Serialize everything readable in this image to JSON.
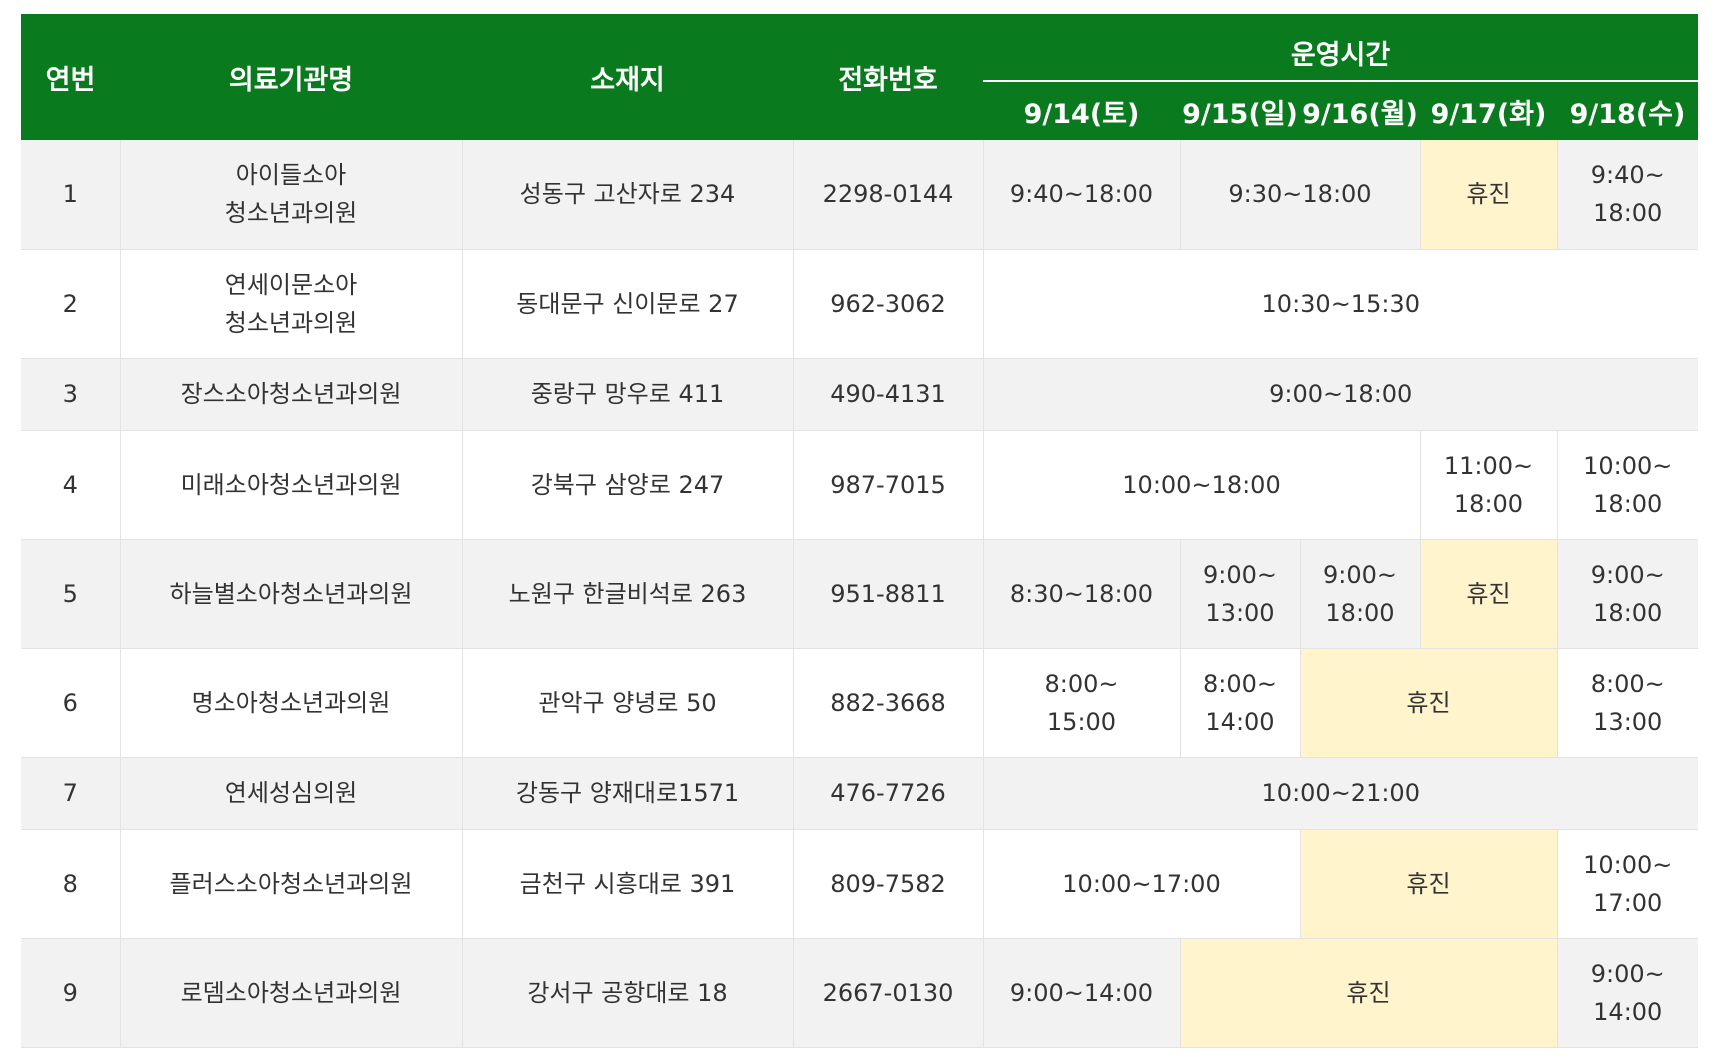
{
  "header": {
    "col_no": "연번",
    "col_name": "의료기관명",
    "col_address": "소재지",
    "col_phone": "전화번호",
    "group_hours": "운영시간",
    "dates": [
      "9/14(토)",
      "9/15(일)",
      "9/16(월)",
      "9/17(화)",
      "9/18(수)"
    ]
  },
  "closed_label": "휴진",
  "colors": {
    "header_bg": "#0a7a1e",
    "closed_bg": "#fff4cc",
    "row_alt_bg": "#f2f2f2"
  },
  "rows": [
    {
      "no": "1",
      "name": "아이들소아\n청소년과의원",
      "address": "성동구 고산자로 234",
      "phone": "2298-0144",
      "hours": [
        {
          "text": "9:40~18:00",
          "span": 1
        },
        {
          "text": "9:30~18:00",
          "span": 2
        },
        {
          "text": "휴진",
          "span": 1,
          "closed": true
        },
        {
          "text": "9:40~\n18:00",
          "span": 1
        }
      ]
    },
    {
      "no": "2",
      "name": "연세이문소아\n청소년과의원",
      "address": "동대문구 신이문로 27",
      "phone": "962-3062",
      "hours": [
        {
          "text": "10:30~15:30",
          "span": 5
        }
      ]
    },
    {
      "no": "3",
      "name": "장스소아청소년과의원",
      "address": "중랑구 망우로 411",
      "phone": "490-4131",
      "hours": [
        {
          "text": "9:00~18:00",
          "span": 5
        }
      ]
    },
    {
      "no": "4",
      "name": "미래소아청소년과의원",
      "address": "강북구 삼양로 247",
      "phone": "987-7015",
      "hours": [
        {
          "text": "10:00~18:00",
          "span": 3
        },
        {
          "text": "11:00~\n18:00",
          "span": 1
        },
        {
          "text": "10:00~\n18:00",
          "span": 1
        }
      ]
    },
    {
      "no": "5",
      "name": "하늘별소아청소년과의원",
      "address": "노원구 한글비석로 263",
      "phone": "951-8811",
      "hours": [
        {
          "text": "8:30~18:00",
          "span": 1
        },
        {
          "text": "9:00~\n13:00",
          "span": 1
        },
        {
          "text": "9:00~\n18:00",
          "span": 1
        },
        {
          "text": "휴진",
          "span": 1,
          "closed": true
        },
        {
          "text": "9:00~\n18:00",
          "span": 1
        }
      ]
    },
    {
      "no": "6",
      "name": "명소아청소년과의원",
      "address": "관악구 양녕로 50",
      "phone": "882-3668",
      "hours": [
        {
          "text": "8:00~\n15:00",
          "span": 1
        },
        {
          "text": "8:00~\n14:00",
          "span": 1
        },
        {
          "text": "휴진",
          "span": 2,
          "closed": true
        },
        {
          "text": "8:00~\n13:00",
          "span": 1
        }
      ]
    },
    {
      "no": "7",
      "name": "연세성심의원",
      "address": "강동구 양재대로1571",
      "phone": "476-7726",
      "hours": [
        {
          "text": "10:00~21:00",
          "span": 5
        }
      ]
    },
    {
      "no": "8",
      "name": "플러스소아청소년과의원",
      "address": "금천구 시흥대로 391",
      "phone": "809-7582",
      "hours": [
        {
          "text": "10:00~17:00",
          "span": 2
        },
        {
          "text": "휴진",
          "span": 2,
          "closed": true
        },
        {
          "text": "10:00~\n17:00",
          "span": 1
        }
      ]
    },
    {
      "no": "9",
      "name": "로뎀소아청소년과의원",
      "address": "강서구 공항대로 18",
      "phone": "2667-0130",
      "hours": [
        {
          "text": "9:00~14:00",
          "span": 1
        },
        {
          "text": "휴진",
          "span": 3,
          "closed": true
        },
        {
          "text": "9:00~\n14:00",
          "span": 1
        }
      ]
    }
  ]
}
